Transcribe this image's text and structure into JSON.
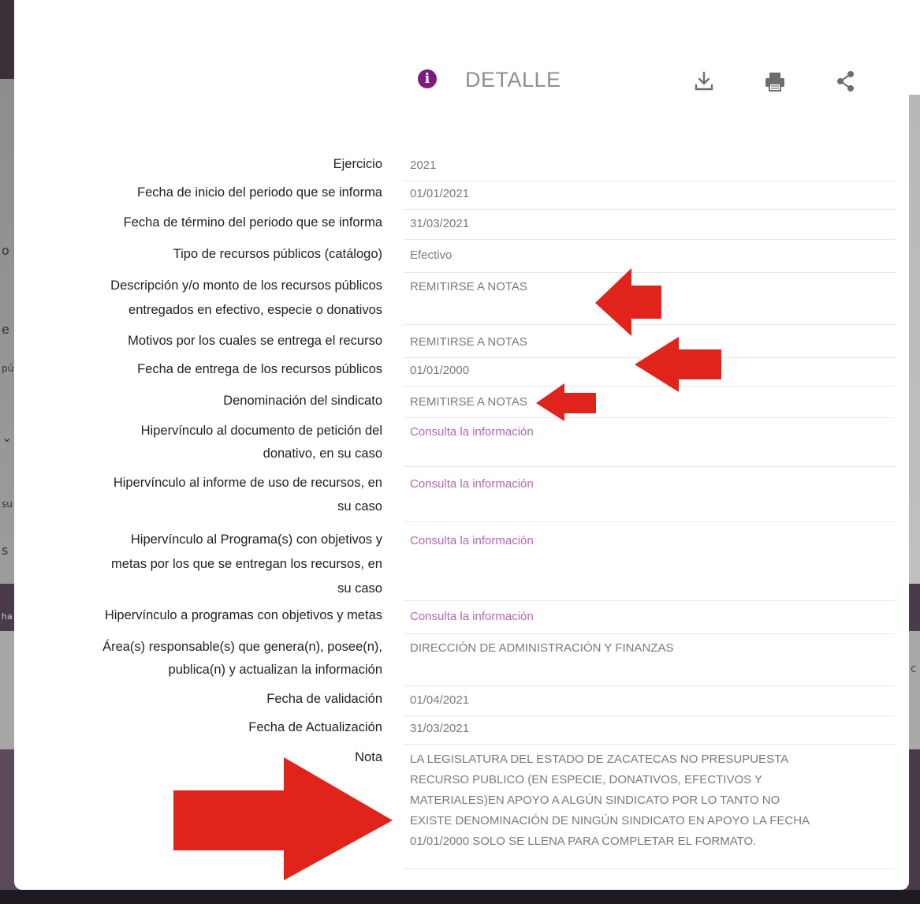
{
  "modal": {
    "title": "DETALLE",
    "icons": [
      "info-icon",
      "download-icon",
      "print-icon",
      "share-icon"
    ]
  },
  "rows": [
    {
      "label": "Ejercicio",
      "value": "2021"
    },
    {
      "label": "Fecha de inicio del periodo que se informa",
      "value": "01/01/2021"
    },
    {
      "label": "Fecha de término del periodo que se informa",
      "value": "31/03/2021"
    },
    {
      "label": "Tipo de recursos públicos (catálogo)",
      "value": "Efectivo"
    },
    {
      "label_lines": [
        "Descripción y/o monto de los recursos públicos",
        "entregados en efectivo, especie o donativos"
      ],
      "value": "REMITIRSE A NOTAS"
    },
    {
      "label": "Motivos por los cuales se entrega el recurso",
      "value": "REMITIRSE A NOTAS"
    },
    {
      "label": "Fecha de entrega de los recursos públicos",
      "value": "01/01/2000"
    },
    {
      "label": "Denominación del sindicato",
      "value": "REMITIRSE A NOTAS"
    },
    {
      "label_lines": [
        "Hipervínculo al documento de petición del",
        "donativo, en su caso"
      ],
      "value": "Consulta la información"
    },
    {
      "label_lines": [
        "Hipervínculo al informe de uso de recursos, en",
        "su caso"
      ],
      "value": "Consulta la información"
    },
    {
      "label_lines": [
        "Hipervínculo al Programa(s) con objetivos y",
        "metas por los que se entregan los recursos, en",
        "su caso"
      ],
      "value": "Consulta la información"
    },
    {
      "label": "Hipervínculo a programas con objetivos y metas",
      "value": "Consulta la información"
    },
    {
      "label_lines": [
        "Área(s) responsable(s) que genera(n), posee(n),",
        "publica(n) y actualizan la información"
      ],
      "value": "DIRECCIÓN DE ADMINISTRACIÓN Y FINANZAS"
    },
    {
      "label": "Fecha de validación",
      "value": "01/04/2021"
    },
    {
      "label": "Fecha de Actualización",
      "value": "31/03/2021"
    },
    {
      "label": "Nota",
      "value_lines": [
        "LA LEGISLATURA DEL ESTADO DE ZACATECAS NO PRESUPUESTA",
        "RECURSO PUBLICO (EN ESPECIE, DONATIVOS, EFECTIVOS Y",
        "MATERIALES)EN APOYO A ALGÚN SINDICATO POR LO TANTO NO",
        "EXISTE DENOMINACIÓN DE NINGÚN SINDICATO EN APOYO LA FECHA",
        "01/01/2000 SOLO SE LLENA PARA COMPLETAR EL FORMATO."
      ]
    }
  ],
  "background_fragments": [
    "o",
    "e",
    "pú",
    "⌄",
    "su",
    "s",
    "ha",
    "c"
  ],
  "colors": {
    "accent": "#7b1e7a",
    "link": "#b069b3",
    "arrow": "#e0231b"
  }
}
